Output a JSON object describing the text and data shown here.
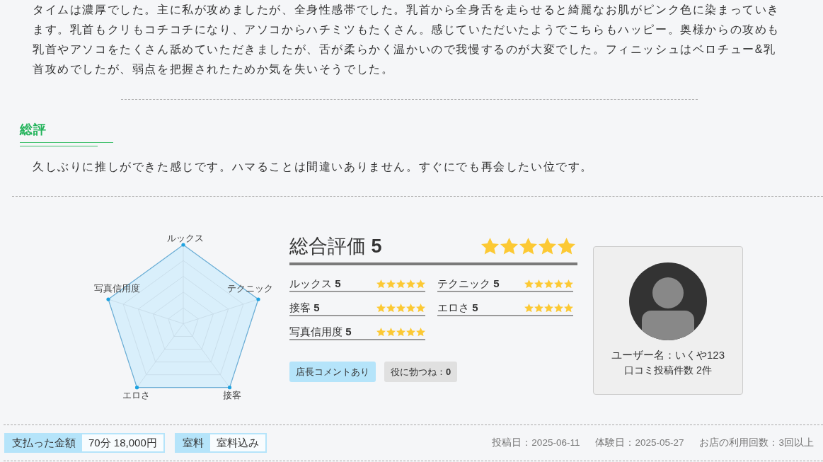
{
  "review": {
    "body": "タイムは濃厚でした。主に私が攻めましたが、全身性感帯でした。乳首から全身舌を走らせると綺麗なお肌がピンク色に染まっていきます。乳首もクリもコチコチになり、アソコからハチミツもたくさん。感じていただいたようでこちらもハッピー。奥様からの攻めも乳首やアソコをたくさん舐めていただきましたが、舌が柔らかく温かいので我慢するのが大変でした。フィニッシュはベロチュー&乳首攻めでしたが、弱点を把握されたためか気を失いそうでした。",
    "summary": {
      "heading": "総評",
      "text": "久しぶりに推しができた感じです。ハマることは間違いありません。すぐにでも再会したい位です。"
    }
  },
  "ratings": {
    "radar": {
      "axes": [
        "ルックス",
        "テクニック",
        "接客",
        "エロさ",
        "写真信用度"
      ]
    },
    "overall": {
      "title": "総合評価 **5**",
      "stars": 5
    },
    "items": [
      {
        "label": "ルックス **5**",
        "stars": 5
      },
      {
        "label": "テクニック **5**",
        "stars": 5
      },
      {
        "label": "接客 **5**",
        "stars": 5
      },
      {
        "label": "エロさ **5**",
        "stars": 5
      },
      {
        "label": "写真信用度 **5**",
        "stars": 5
      }
    ],
    "tags": [
      {
        "kind": "badge",
        "text": "店長コメントあり"
      },
      {
        "kind": "vote",
        "text": "役に勃つね：**0**"
      }
    ]
  },
  "reviewer": {
    "name": "ユーザー名：いくや123",
    "post_count": "口コミ投稿件数 2件"
  },
  "details": [
    {
      "label": "支払った金額",
      "value": "70分 18,000円"
    },
    {
      "label": "室料",
      "value": "室料込み"
    }
  ],
  "meta": [
    "投稿日：2025-06-11",
    "体験日：2025-05-27",
    "お店の利用回数：3回以上"
  ]
}
